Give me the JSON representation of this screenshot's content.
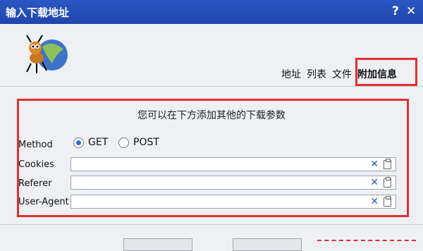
{
  "window": {
    "title": "输入下载地址",
    "help": "?",
    "close": "✕"
  },
  "tabs": [
    "地址",
    "列表",
    "文件",
    "附加信息"
  ],
  "panel": {
    "heading": "您可以在下方添加其他的下载参数",
    "method": {
      "label": "Method",
      "options": [
        "GET",
        "POST"
      ],
      "selected": "GET"
    },
    "fields": [
      {
        "label": "Cookies",
        "value": ""
      },
      {
        "label": "Referer",
        "value": ""
      },
      {
        "label": "User-Agent",
        "value": ""
      }
    ]
  },
  "icons": {
    "clear": "✕"
  },
  "colors": {
    "titlebar": "#2b56c4",
    "highlight": "#e23030",
    "accent": "#2a6fd6"
  }
}
